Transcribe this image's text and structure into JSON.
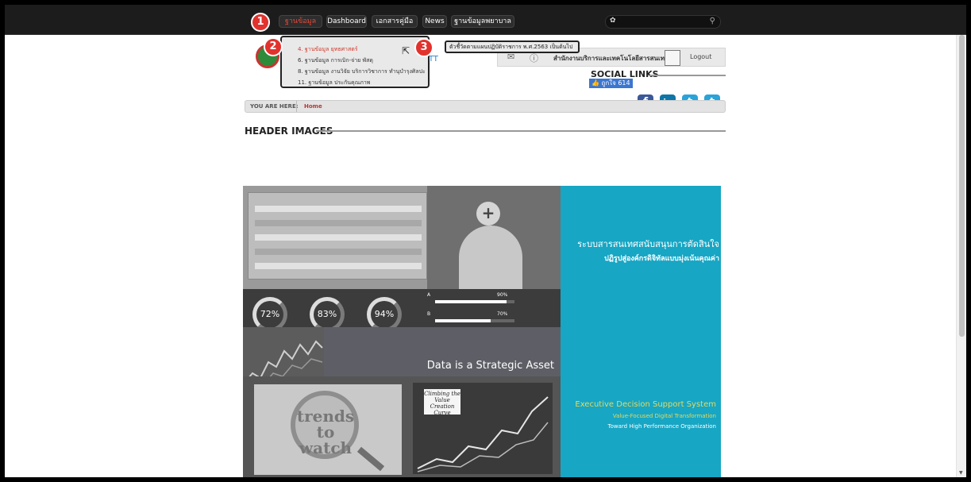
{
  "topbar": {
    "nav": [
      {
        "label": "ฐานข้อมูล",
        "active": true
      },
      {
        "label": "Dashboard"
      },
      {
        "label": "เอกสารคู่มือ"
      },
      {
        "label": "News"
      },
      {
        "label": "ฐานข้อมูลพยาบาล"
      }
    ],
    "search": {
      "lang": "✿",
      "icon": "search-icon"
    }
  },
  "dropdown": {
    "items": [
      {
        "label": "4. ฐานข้อมูล ยุทธศาสตร์",
        "active": true
      },
      {
        "label": "6. ฐานข้อมูล การเบิก-จ่าย พัสดุ"
      },
      {
        "label": "8. ฐานข้อมูล งานวิจัย บริการวิชาการ ทำนุบำรุงศิลปะ"
      },
      {
        "label": "11. ฐานข้อมูล ประกันคุณภาพ"
      }
    ]
  },
  "tooltip": {
    "text": "ตัวชี้วัดตามแผนปฏิบัติราชการ พ.ศ.2563 เป็นต้นไป"
  },
  "badges": [
    "1",
    "2",
    "3"
  ],
  "header": {
    "link_fragment": "IOTT",
    "org_name": "สำนักงานบริการและเทคโนโลยีสารสนเทศ",
    "logout": "Logout",
    "social_title": "SOCIAL LINKS",
    "fb_like": "👍 ถูกใจ 614",
    "social": [
      "f",
      "in",
      "t",
      "t"
    ]
  },
  "breadcrumb": {
    "label": "YOU ARE HERE:",
    "home": "Home"
  },
  "section": {
    "title": "HEADER IMAGES"
  },
  "banner": {
    "thai_title": "ระบบสารสนเทศสนับสนุนการตัดสินใจ",
    "thai_sub": "ปฏิรูปสู่องค์กรดิจิทัลแบบมุ่งเน้นคุณค่า",
    "gauges": [
      "72%",
      "83%",
      "94%"
    ],
    "bars": [
      {
        "label": "A",
        "value": 90
      },
      {
        "label": "B",
        "value": 70
      }
    ],
    "bar_texts": [
      "90%",
      "70%"
    ],
    "strategic": "Data is a Strategic Asset",
    "trends": "trends to watch",
    "climb": "Climbing the Value Creation Curve",
    "eng_title": "Executive Decision Support System",
    "eng_sub": "Value-Focused Digital Transformation",
    "eng_sub2": "Toward High Performance Organization"
  },
  "colors": {
    "accent": "#17a6c4",
    "badge": "#e2322e",
    "facebook": "#3b5998",
    "twitter": "#2aa3d9",
    "linkedin": "#0e76a8"
  }
}
